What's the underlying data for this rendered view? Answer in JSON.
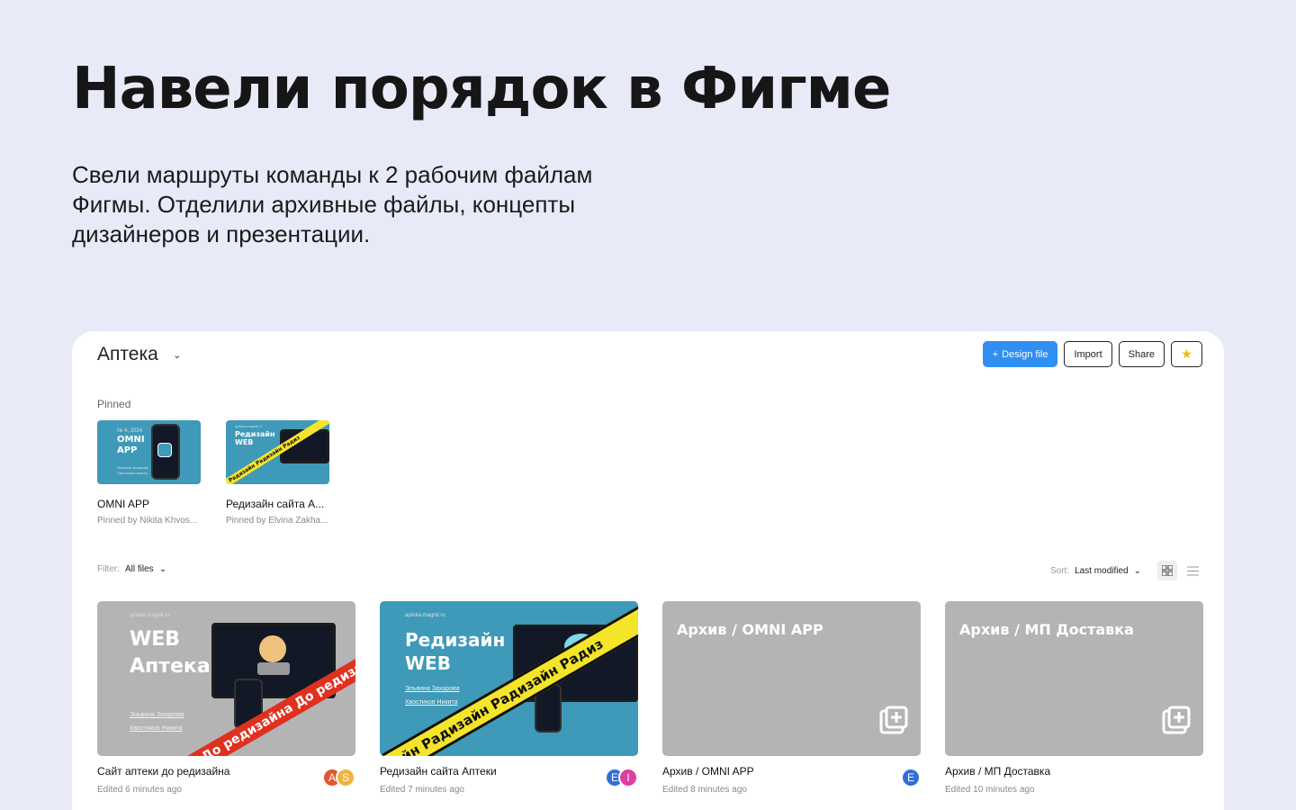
{
  "hero": {
    "title": "Навели порядок в Фигме",
    "subtitle": "Свели маршруты команды к 2 рабочим файлам Фигмы. Отделили архивные файлы, концепты дизайнеров и презентации."
  },
  "project": {
    "title": "Аптека",
    "toolbar": {
      "design_file": "Design file",
      "import": "Import",
      "share": "Share"
    }
  },
  "pinned": {
    "label": "Pinned",
    "items": [
      {
        "name": "OMNI APP",
        "meta": "Pinned by Nikita Khvos...",
        "thumb_title": "OMNI\nAPP",
        "thumb_small": "№ 4, 2024",
        "thumb_people": "Эльвина Захарова\nХвостиков Никита"
      },
      {
        "name": "Редизайн сайта А...",
        "meta": "Pinned by Elvina Zakha...",
        "thumb_title": "Редизайн\nWEB",
        "thumb_small": "apteka.magnit.ru",
        "tape": "Радизайн  Радизайн  Радиз"
      }
    ]
  },
  "filter": {
    "label": "Filter:",
    "value": "All files"
  },
  "sort": {
    "label": "Sort:",
    "value": "Last modified"
  },
  "files": [
    {
      "name": "Сайт аптеки до редизайна",
      "meta": "Edited 6 minutes ago",
      "thumb_small": "apteka.magnit.ru",
      "thumb_title": "WEB\nАптека",
      "link1": "Эльвина Захарова",
      "link2": "Хвостиков Никита",
      "tape": "До редизайна   До редизайна",
      "avatars": [
        {
          "letter": "A",
          "color": "#e2572f"
        },
        {
          "letter": "S",
          "color": "#f2b33c"
        }
      ]
    },
    {
      "name": "Редизайн сайта Аптеки",
      "meta": "Edited 7 minutes ago",
      "thumb_small": "apteka.magnit.ru",
      "thumb_title": "Редизайн\nWEB",
      "link1": "Эльвина Захарова",
      "link2": "Хвостиков Никита",
      "tape": "айн   Радизайн   Радизайн   Радиз",
      "avatars": [
        {
          "letter": "E",
          "color": "#2f6fd6"
        },
        {
          "letter": "I",
          "color": "#e03ea2"
        }
      ]
    },
    {
      "name": "Архив / OMNI APP",
      "meta": "Edited 8 minutes ago",
      "thumb_title": "Архив / OMNI APP",
      "avatars": [
        {
          "letter": "E",
          "color": "#2f6fd6"
        }
      ]
    },
    {
      "name": "Архив / МП Доставка",
      "meta": "Edited 10 minutes ago",
      "thumb_title": "Архив / МП Доставка",
      "avatars": []
    }
  ],
  "colors": {
    "page_bg": "#e8eaf8",
    "accent": "#2f8ff2",
    "teal": "#3e9ab8",
    "archive_gray": "#b4b4b4",
    "red_tape": "#e0301e",
    "yellow_tape": "#f5e52a"
  },
  "icons": {
    "add": "plus-icon",
    "star": "star-icon",
    "grid": "grid-view-icon",
    "list": "list-view-icon",
    "dropdown": "chevron-down-icon"
  }
}
